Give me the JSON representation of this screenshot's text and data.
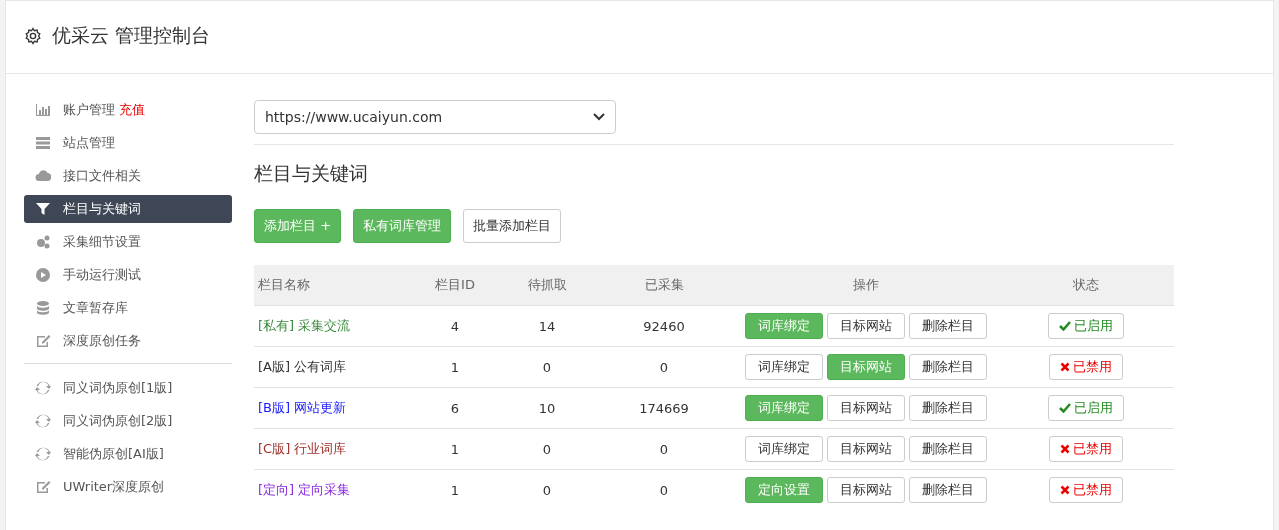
{
  "header": {
    "title": "优采云 管理控制台"
  },
  "sidebar": {
    "groups": [
      [
        {
          "label": "账户管理",
          "badge": "充值",
          "selected": false
        },
        {
          "label": "站点管理",
          "selected": false
        },
        {
          "label": "接口文件相关",
          "selected": false
        },
        {
          "label": "栏目与关键词",
          "selected": true
        },
        {
          "label": "采集细节设置",
          "selected": false
        },
        {
          "label": "手动运行测试",
          "selected": false
        },
        {
          "label": "文章暂存库",
          "selected": false
        },
        {
          "label": "深度原创任务",
          "selected": false
        }
      ],
      [
        {
          "label": "同义词伪原创[1版]",
          "selected": false
        },
        {
          "label": "同义词伪原创[2版]",
          "selected": false
        },
        {
          "label": "智能伪原创[AI版]",
          "selected": false
        },
        {
          "label": "UWriter深度原创",
          "selected": false
        }
      ]
    ]
  },
  "site_select": {
    "value": "https://www.ucaiyun.com"
  },
  "section_title": "栏目与关键词",
  "toolbar": [
    {
      "label": "添加栏目 +",
      "primary": true
    },
    {
      "label": "私有词库管理",
      "primary": true
    },
    {
      "label": "批量添加栏目",
      "primary": false
    }
  ],
  "table": {
    "columns": [
      "栏目名称",
      "栏目ID",
      "待抓取",
      "已采集",
      "操作",
      "状态"
    ],
    "rows": [
      {
        "tag": "[私有]",
        "name": "采集交流",
        "color": "#3c8a3c",
        "col2": "4",
        "col3": "14",
        "col4": "92460",
        "actions": [
          {
            "label": "词库绑定",
            "primary": true
          },
          {
            "label": "目标网站",
            "primary": false
          },
          {
            "label": "删除栏目",
            "primary": false
          }
        ],
        "status": "已启用",
        "enabled": true
      },
      {
        "tag": "[A版]",
        "name": "公有词库",
        "color": "#333333",
        "col2": "1",
        "col3": "0",
        "col4": "0",
        "actions": [
          {
            "label": "词库绑定",
            "primary": false
          },
          {
            "label": "目标网站",
            "primary": true
          },
          {
            "label": "删除栏目",
            "primary": false
          }
        ],
        "status": "已禁用",
        "enabled": false
      },
      {
        "tag": "[B版]",
        "name": "网站更新",
        "color": "#1a1aff",
        "col2": "6",
        "col3": "10",
        "col4": "174669",
        "actions": [
          {
            "label": "词库绑定",
            "primary": true
          },
          {
            "label": "目标网站",
            "primary": false
          },
          {
            "label": "删除栏目",
            "primary": false
          }
        ],
        "status": "已启用",
        "enabled": true
      },
      {
        "tag": "[C版]",
        "name": "行业词库",
        "color": "#a0302c",
        "col2": "1",
        "col3": "0",
        "col4": "0",
        "actions": [
          {
            "label": "词库绑定",
            "primary": false
          },
          {
            "label": "目标网站",
            "primary": false
          },
          {
            "label": "删除栏目",
            "primary": false
          }
        ],
        "status": "已禁用",
        "enabled": false
      },
      {
        "tag": "[定向]",
        "name": "定向采集",
        "color": "#8a2be2",
        "col2": "1",
        "col3": "0",
        "col4": "0",
        "actions": [
          {
            "label": "定向设置",
            "primary": true
          },
          {
            "label": "目标网站",
            "primary": false
          },
          {
            "label": "删除栏目",
            "primary": false
          }
        ],
        "status": "已禁用",
        "enabled": false
      }
    ]
  }
}
